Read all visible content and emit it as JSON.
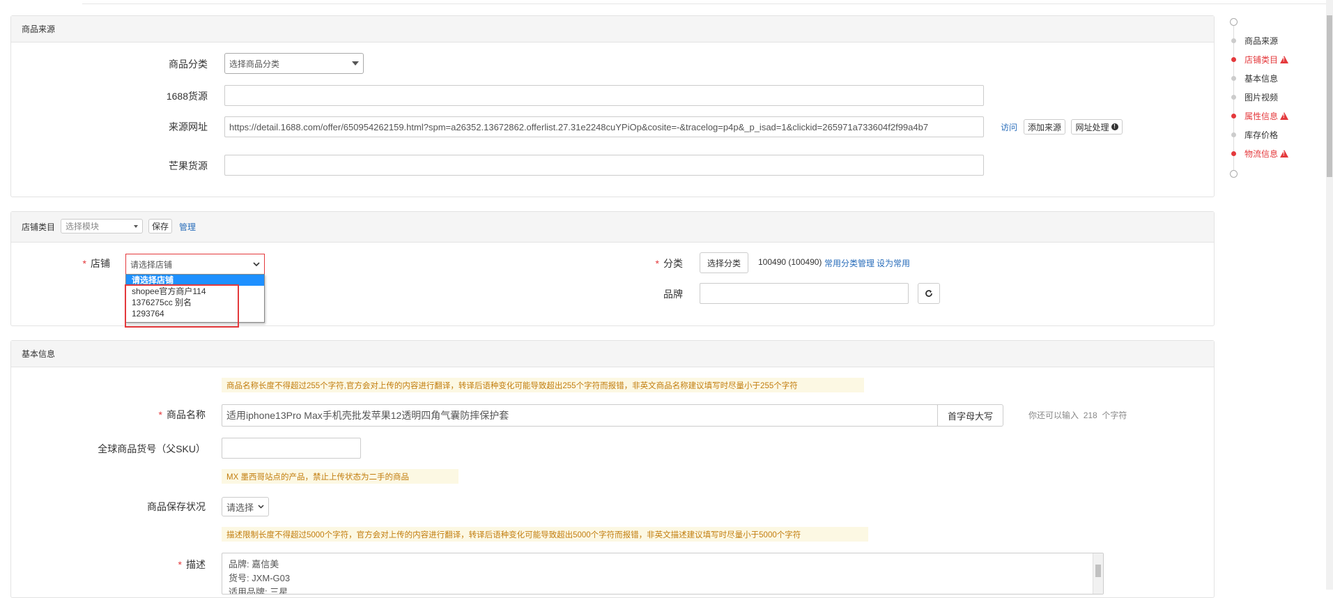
{
  "source_section": {
    "title": "商品来源",
    "category_label": "商品分类",
    "category_select": "选择商品分类",
    "src1688_label": "1688货源",
    "src1688_value": "",
    "url_label": "来源网址",
    "url_value": "https://detail.1688.com/offer/650954262159.html?spm=a26352.13672862.offerlist.27.31e2248cuYPiOp&cosite=-&tracelog=p4p&_p_isad=1&clickid=265971a733604f2f99a4b7",
    "visit_link": "访问",
    "add_source_button": "添加来源",
    "url_process_button": "网址处理",
    "mango_label": "芒果货源",
    "mango_value": ""
  },
  "shop_section": {
    "title": "店铺类目",
    "module_select": "选择模块",
    "save_button": "保存",
    "manage_link": "管理",
    "shop_label": "店铺",
    "shop_select": "请选择店铺",
    "shop_options": [
      "请选择店铺",
      "shopee官方商户114",
      "1376275cc 别名",
      "1293764"
    ],
    "category_label": "分类",
    "choose_category_button": "选择分类",
    "category_value": "100490 (100490)",
    "common_category_link": "常用分类管理",
    "set_common_link": "设为常用",
    "brand_label": "品牌",
    "brand_value": ""
  },
  "basic_section": {
    "title": "基本信息",
    "name_tip": "商品名称长度不得超过255个字符,官方会对上传的内容进行翻译，转译后语种变化可能导致超出255个字符而报错，非英文商品名称建议填写时尽量小于255个字符",
    "name_label": "商品名称",
    "name_value": "适用iphone13Pro Max手机壳批发苹果12透明四角气囊防摔保护套",
    "capitalize_button": "首字母大写",
    "char_remaining_prefix": "你还可以输入",
    "char_remaining_count": "218",
    "char_remaining_suffix": "个字符",
    "sku_label": "全球商品货号（父SKU）",
    "sku_value": "",
    "mx_tip": "MX 墨西哥站点的产品，禁止上传状态为二手的商品",
    "condition_label": "商品保存状况",
    "condition_select": "请选择",
    "desc_tip": "描述限制长度不得超过5000个字符，官方会对上传的内容进行翻译，转译后语种变化可能导致超出5000个字符而报错，非英文描述建议填写时尽量小于5000个字符",
    "desc_label": "描述",
    "desc_lines": [
      "品牌: 嘉信美",
      "货号: JXM-G03",
      "适用品牌: 三星"
    ]
  },
  "side_nav": {
    "items": [
      {
        "label": "商品来源",
        "error": false
      },
      {
        "label": "店铺类目",
        "error": true
      },
      {
        "label": "基本信息",
        "error": false
      },
      {
        "label": "图片视频",
        "error": false
      },
      {
        "label": "属性信息",
        "error": true
      },
      {
        "label": "库存价格",
        "error": false
      },
      {
        "label": "物流信息",
        "error": true
      }
    ]
  },
  "colors": {
    "error": "#e4393c",
    "link": "#2a6ebb",
    "tip_bg": "#fcf8e3",
    "tip_text": "#c27d0e",
    "highlight": "#1e90ff"
  }
}
